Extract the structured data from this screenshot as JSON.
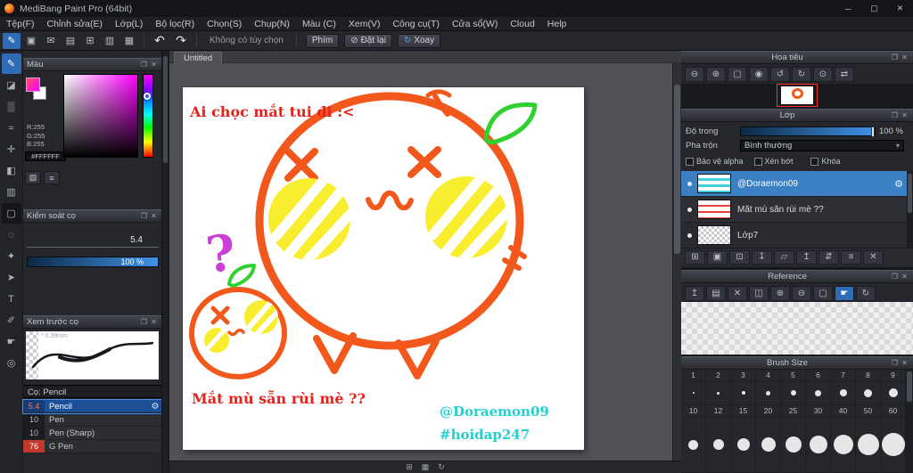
{
  "window": {
    "title": "MediBang Paint Pro (64bit)",
    "minimize": "─",
    "maximize": "▢",
    "close": "✕"
  },
  "menu": {
    "items": [
      "Tệp(F)",
      "Chỉnh sửa(E)",
      "Lớp(L)",
      "Bộ lọc(R)",
      "Chọn(S)",
      "Chụp(N)",
      "Màu (C)",
      "Xem(V)",
      "Công cụ(T)",
      "Cửa sổ(W)",
      "Cloud",
      "Help"
    ]
  },
  "toolbar": {
    "icons": [
      {
        "name": "brush-icon",
        "glyph": "✎"
      },
      {
        "name": "save-icon",
        "glyph": "▣"
      },
      {
        "name": "comment-icon",
        "glyph": "✉"
      },
      {
        "name": "material-icon",
        "glyph": "▤"
      },
      {
        "name": "new-canvas-icon",
        "glyph": "⊞"
      },
      {
        "name": "ruler-icon",
        "glyph": "▥"
      },
      {
        "name": "snap-icon",
        "glyph": "▦"
      }
    ],
    "undo": "↶",
    "redo": "↷",
    "no_option_label": "Không có tùy chọn",
    "keys_button": "Phím",
    "reset_button": "Đặt lại",
    "reset_icon": "⊘",
    "rotate_button": "Xoay",
    "rotate_icon": "↻"
  },
  "tools": [
    {
      "name": "pen-tool-icon",
      "glyph": "✎"
    },
    {
      "name": "eraser-tool-icon",
      "glyph": "◪"
    },
    {
      "name": "airbrush-tool-icon",
      "glyph": "▒"
    },
    {
      "name": "blur-tool-icon",
      "glyph": "≈"
    },
    {
      "name": "move-tool-icon",
      "glyph": "✛"
    },
    {
      "name": "fill-tool-icon",
      "glyph": "◧"
    },
    {
      "name": "gradient-tool-icon",
      "glyph": "▥"
    },
    {
      "name": "select-tool-icon",
      "glyph": "▢"
    },
    {
      "name": "lasso-tool-icon",
      "glyph": "◌"
    },
    {
      "name": "magic-wand-tool-icon",
      "glyph": "✦"
    },
    {
      "name": "select-pen-tool-icon",
      "glyph": "➤"
    },
    {
      "name": "text-tool-icon",
      "glyph": "T"
    },
    {
      "name": "eyedropper-tool-icon",
      "glyph": "✐"
    },
    {
      "name": "hand-tool-icon",
      "glyph": "☛"
    },
    {
      "name": "zoom-tool-icon",
      "glyph": "◎"
    }
  ],
  "document": {
    "tab_title": "Untitled"
  },
  "artwork": {
    "caption_top": "Ai chọc mắt tui đi :<",
    "caption_bottom": "Mắt mù sẵn rùi mè ??",
    "signature_line1": "@Doraemon09",
    "signature_line2": "#hoidap247",
    "question_mark": "?",
    "colors": {
      "outline_orange": "#f2581c",
      "cheek_yellow": "#f8ee2f",
      "leaf_green": "#2fd12f",
      "question_purple": "#cb3fd6",
      "caption_red": "#e3231c",
      "signature_cyan": "#25cfcf"
    }
  },
  "color_panel": {
    "title": "Màu",
    "r": "R:255",
    "g": "G:255",
    "b": "B:255",
    "hex": "#FFFFFF"
  },
  "brush_control": {
    "title": "Kiểm soát cọ",
    "size_value": "5.4",
    "opacity_value": "100 %"
  },
  "brush_preview": {
    "title": "Xem trước cọ",
    "min_size": "* 0.39mm",
    "current_brush": "Cọ: Pencil"
  },
  "brushes": [
    {
      "size": "5.4",
      "name": "Pencil"
    },
    {
      "size": "10",
      "name": "Pen"
    },
    {
      "size": "10",
      "name": "Pen (Sharp)"
    },
    {
      "size": "76",
      "name": "G Pen"
    }
  ],
  "navigator": {
    "title": "Hoa tiêu",
    "icons": [
      {
        "name": "zoom-out-icon",
        "glyph": "⊖"
      },
      {
        "name": "zoom-in-icon",
        "glyph": "⊕"
      },
      {
        "name": "fit-window-icon",
        "glyph": "▢"
      },
      {
        "name": "actual-size-icon",
        "glyph": "◉"
      },
      {
        "name": "rotate-left-icon",
        "glyph": "↺"
      },
      {
        "name": "rotate-right-icon",
        "glyph": "↻"
      },
      {
        "name": "reset-rotation-icon",
        "glyph": "⊙"
      },
      {
        "name": "flip-horizontal-icon",
        "glyph": "⇄"
      }
    ]
  },
  "layers": {
    "title": "Lớp",
    "opacity_label": "Độ trong",
    "opacity_value": "100 %",
    "blend_label": "Pha trộn",
    "blend_value": "Bình thường",
    "protect_alpha": "Bảo vệ alpha",
    "clipping": "Xén bớt",
    "lock": "Khóa",
    "items": [
      {
        "name": "@Doraemon09"
      },
      {
        "name": "Mắt mù sẵn rùi mè ??"
      },
      {
        "name": "Lớp7"
      }
    ],
    "tools": [
      {
        "name": "add-layer-icon",
        "glyph": "⊞"
      },
      {
        "name": "add-folder-icon",
        "glyph": "▣"
      },
      {
        "name": "duplicate-layer-icon",
        "glyph": "⊡"
      },
      {
        "name": "merge-down-icon",
        "glyph": "↧"
      },
      {
        "name": "layer-folder-icon",
        "glyph": "▱"
      },
      {
        "name": "move-layer-up-icon",
        "glyph": "↥"
      },
      {
        "name": "move-layer-down-icon",
        "glyph": "⇵"
      },
      {
        "name": "layer-menu-icon",
        "glyph": "≡"
      },
      {
        "name": "delete-layer-icon",
        "glyph": "✕"
      }
    ]
  },
  "reference": {
    "title": "Reference",
    "icons": [
      {
        "name": "import-image-icon",
        "glyph": "↥"
      },
      {
        "name": "open-image-icon",
        "glyph": "▤"
      },
      {
        "name": "clear-image-icon",
        "glyph": "✕"
      },
      {
        "name": "split-view-icon",
        "glyph": "◫"
      },
      {
        "name": "zoom-in-icon",
        "glyph": "⊕"
      },
      {
        "name": "zoom-out-icon",
        "glyph": "⊖"
      },
      {
        "name": "fit-view-icon",
        "glyph": "▢"
      },
      {
        "name": "hand-pan-icon",
        "glyph": "☛"
      },
      {
        "name": "refresh-icon",
        "glyph": "↻"
      }
    ]
  },
  "brush_size": {
    "title": "Brush Size",
    "small": [
      "1",
      "2",
      "3",
      "4",
      "5",
      "6",
      "7",
      "8",
      "9"
    ],
    "large": [
      "10",
      "12",
      "15",
      "20",
      "25",
      "30",
      "40",
      "50",
      "60"
    ]
  },
  "statusbar": {
    "icons": [
      {
        "name": "grid-toggle-icon",
        "glyph": "⊞"
      },
      {
        "name": "transparent-bg-icon",
        "glyph": "▦"
      },
      {
        "name": "reset-view-icon",
        "glyph": "↻"
      }
    ]
  },
  "glyphs": {
    "gear": "⚙",
    "dropdown": "▾",
    "popout": "❐",
    "close": "✕",
    "palette": "▧",
    "sliders": "≡"
  }
}
